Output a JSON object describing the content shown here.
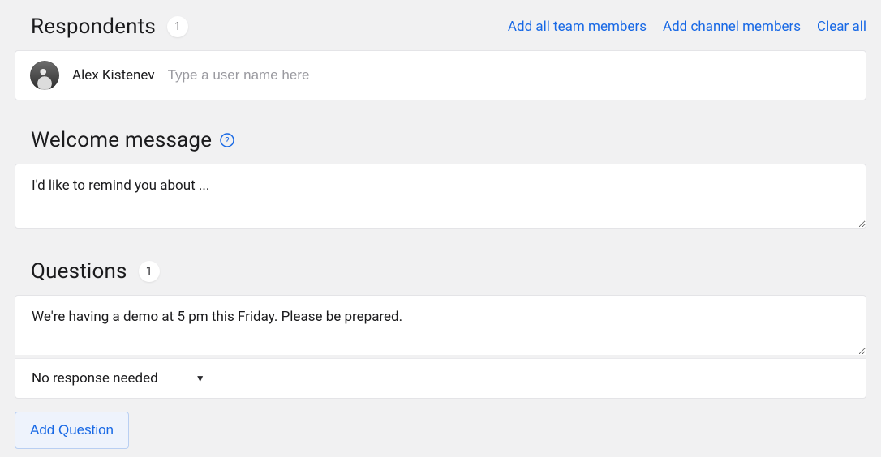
{
  "respondents": {
    "title": "Respondents",
    "count": "1",
    "links": {
      "add_team": "Add all team members",
      "add_channel": "Add channel members",
      "clear_all": "Clear all"
    },
    "chip_name": "Alex Kistenev",
    "input_placeholder": "Type a user name here"
  },
  "welcome": {
    "title": "Welcome message",
    "text": "I'd like to remind you about ..."
  },
  "questions": {
    "title": "Questions",
    "count": "1",
    "items": [
      {
        "text": "We're having a demo at 5 pm this Friday. Please be prepared.",
        "response_type": "No response needed"
      }
    ],
    "add_button": "Add Question"
  }
}
